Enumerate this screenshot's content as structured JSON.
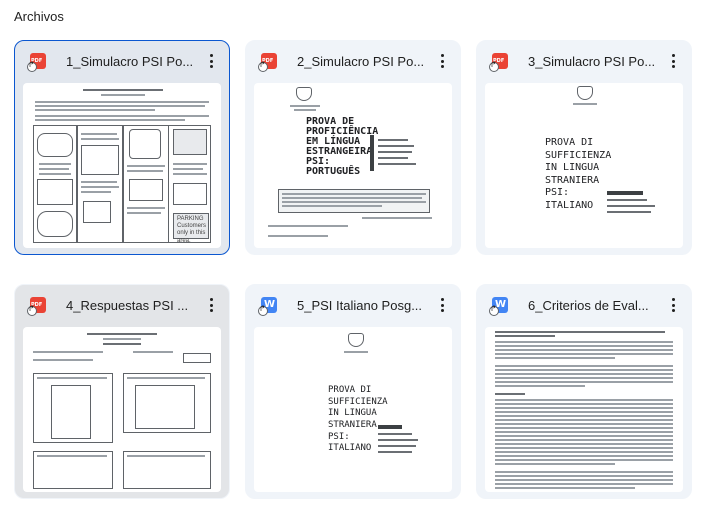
{
  "section": {
    "title": "Archivos"
  },
  "files": [
    {
      "name": "1_Simulacro PSI Po...",
      "type": "pdf"
    },
    {
      "name": "2_Simulacro PSI Po...",
      "type": "pdf"
    },
    {
      "name": "3_Simulacro PSI Po...",
      "type": "pdf"
    },
    {
      "name": "4_Respuestas PSI ...",
      "type": "pdf"
    },
    {
      "name": "5_PSI Italiano Posg...",
      "type": "doc"
    },
    {
      "name": "6_Criterios de Eval...",
      "type": "doc"
    }
  ],
  "previews": {
    "p1": {
      "heading": "English Language Proficiency Test",
      "sub": "TW Reading B1",
      "sign": "PARKING Customers only in this area."
    },
    "p2": {
      "title": "PROVA DI PROFICIÊNCIA EM LÍNGUA ESTRANGEIRA - PSI- PORTUGUÊS",
      "side": "PRUEBA DE SUFICIENCIA DE IDIOMA EXTRANJERO"
    },
    "p3": {
      "title": "PROVA DI SUFFICIENZA IN LINGUA STRANIERA PSI: ITALIANO",
      "side": "PRUEBA DE SUFICIENCIA DE IDIOMA EXTRANJERO"
    },
    "p4": {
      "heading": "English Language Proficiency Test",
      "sub": "TW Reading B1",
      "label": "ANSWER KEY"
    },
    "p5": {
      "title": "PROVA DI SUFFICIENZA IN LINGUA STRANIERA PSI: ITALIANO",
      "side": "PRUEBA DE SUFICIENCIA DE IDIOMA EXTRANJERO"
    },
    "p6": {
      "heading": "Información General Prueba de Suficiencia en Idioma Extranjero (PSI) Posgrado"
    }
  },
  "colors": {
    "pdf": "#ea4335",
    "doc": "#4285f4",
    "selected_border": "#0b57d0",
    "card_bg": "#f0f4f9"
  }
}
